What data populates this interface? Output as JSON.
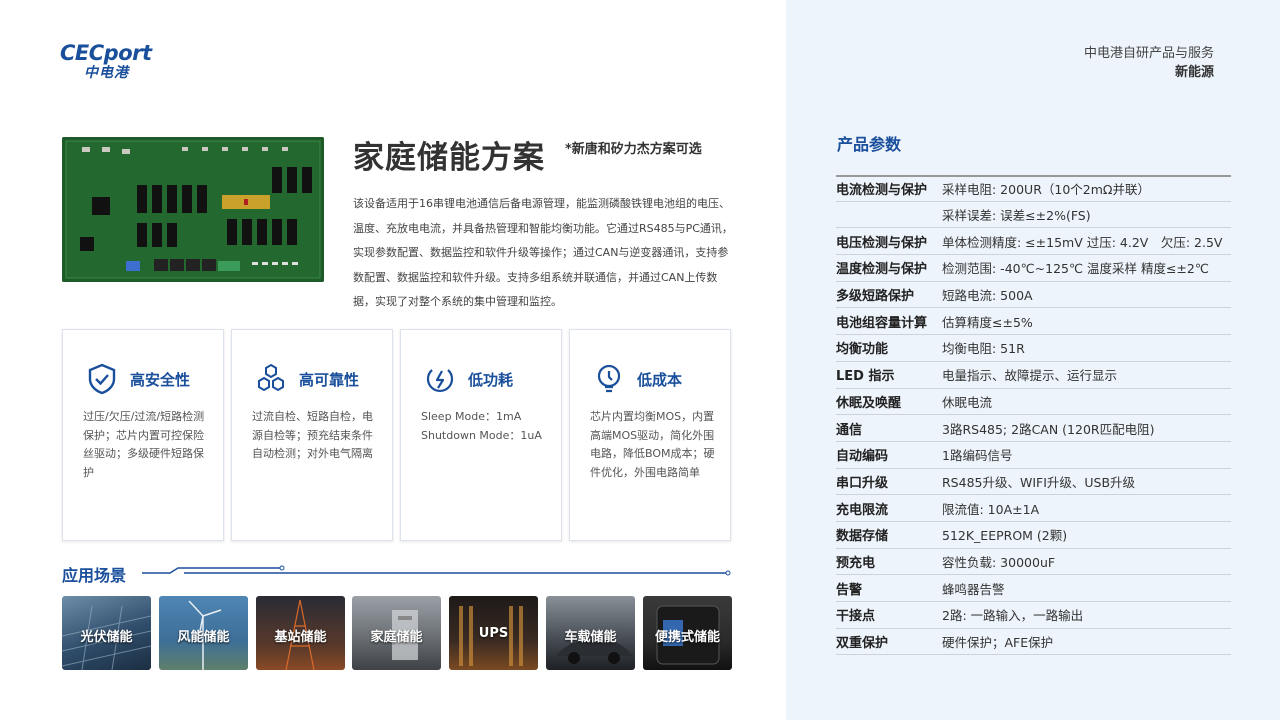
{
  "logo": {
    "en": "CECport",
    "cn": "中电港"
  },
  "header": {
    "line1": "中电港自研产品与服务",
    "line2": "新能源"
  },
  "product": {
    "title": "家庭储能方案",
    "note": "*新唐和矽力杰方案可选",
    "description": "该设备适用于16串锂电池通信后备电源管理，能监测磷酸铁锂电池组的电压、温度、充放电电流，并具备热管理和智能均衡功能。它通过RS485与PC通讯，实现参数配置、数据监控和软件升级等操作；通过CAN与逆变器通讯，支持参数配置、数据监控和软件升级。支持多组系统并联通信，并通过CAN上传数据，实现了对整个系统的集中管理和监控。"
  },
  "features": [
    {
      "icon": "shield-check-icon",
      "title": "高安全性",
      "desc": "过压/欠压/过流/短路检测保护；芯片内置可控保险丝驱动；多级硬件短路保护"
    },
    {
      "icon": "hexagons-icon",
      "title": "高可靠性",
      "desc": "过流自检、短路自检，电源自检等；预充结束条件自动检测；对外电气隔离"
    },
    {
      "icon": "power-icon",
      "title": "低功耗",
      "desc": "Sleep Mode：1mA\nShutdown Mode：1uA"
    },
    {
      "icon": "lightbulb-icon",
      "title": "低成本",
      "desc": "芯片内置均衡MOS，内置高端MOS驱动，简化外围电路，降低BOM成本；硬件优化，外围电路简单"
    }
  ],
  "applications": {
    "title": "应用场景",
    "items": [
      {
        "name": "光伏储能",
        "color": "#2f4d6b"
      },
      {
        "name": "风能储能",
        "color": "#3d6f98"
      },
      {
        "name": "基站储能",
        "color": "#5b3a2a"
      },
      {
        "name": "家庭储能",
        "color": "#6f7479"
      },
      {
        "name": "UPS",
        "color": "#3a2a22"
      },
      {
        "name": "车载储能",
        "color": "#4a5058"
      },
      {
        "name": "便携式储能",
        "color": "#2b2b2b"
      }
    ]
  },
  "specs": {
    "title": "产品参数",
    "rows": [
      {
        "key": "电流检测与保护",
        "value": "采样电阻: 200UR（10个2mΩ并联）"
      },
      {
        "key": "",
        "value": "采样误差: 误差≤±2%(FS)"
      },
      {
        "key": "电压检测与保护",
        "value": "单体检测精度: ≤±15mV 过压: 4.2V　欠压: 2.5V"
      },
      {
        "key": "温度检测与保护",
        "value": "检测范围: -40℃~125℃ 温度采样 精度≤±2℃"
      },
      {
        "key": "多级短路保护",
        "value": "短路电流: 500A"
      },
      {
        "key": "电池组容量计算",
        "value": "估算精度≤±5%"
      },
      {
        "key": "均衡功能",
        "value": "均衡电阻: 51R"
      },
      {
        "key": "LED 指示",
        "value": "电量指示、故障提示、运行显示"
      },
      {
        "key": "休眠及唤醒",
        "value": "休眠电流"
      },
      {
        "key": "通信",
        "value": "3路RS485; 2路CAN (120R匹配电阻)"
      },
      {
        "key": "自动编码",
        "value": "1路编码信号"
      },
      {
        "key": "串口升级",
        "value": "RS485升级、WIFI升级、USB升级"
      },
      {
        "key": "充电限流",
        "value": "限流值: 10A±1A"
      },
      {
        "key": "数据存储",
        "value": "512K_EEPROM (2颗)"
      },
      {
        "key": "预充电",
        "value": "容性负载: 30000uF"
      },
      {
        "key": "告警",
        "value": "蜂鸣器告警"
      },
      {
        "key": "干接点",
        "value": "2路: 一路输入，一路输出"
      },
      {
        "key": "双重保护",
        "value": "硬件保护；AFE保护"
      }
    ]
  }
}
